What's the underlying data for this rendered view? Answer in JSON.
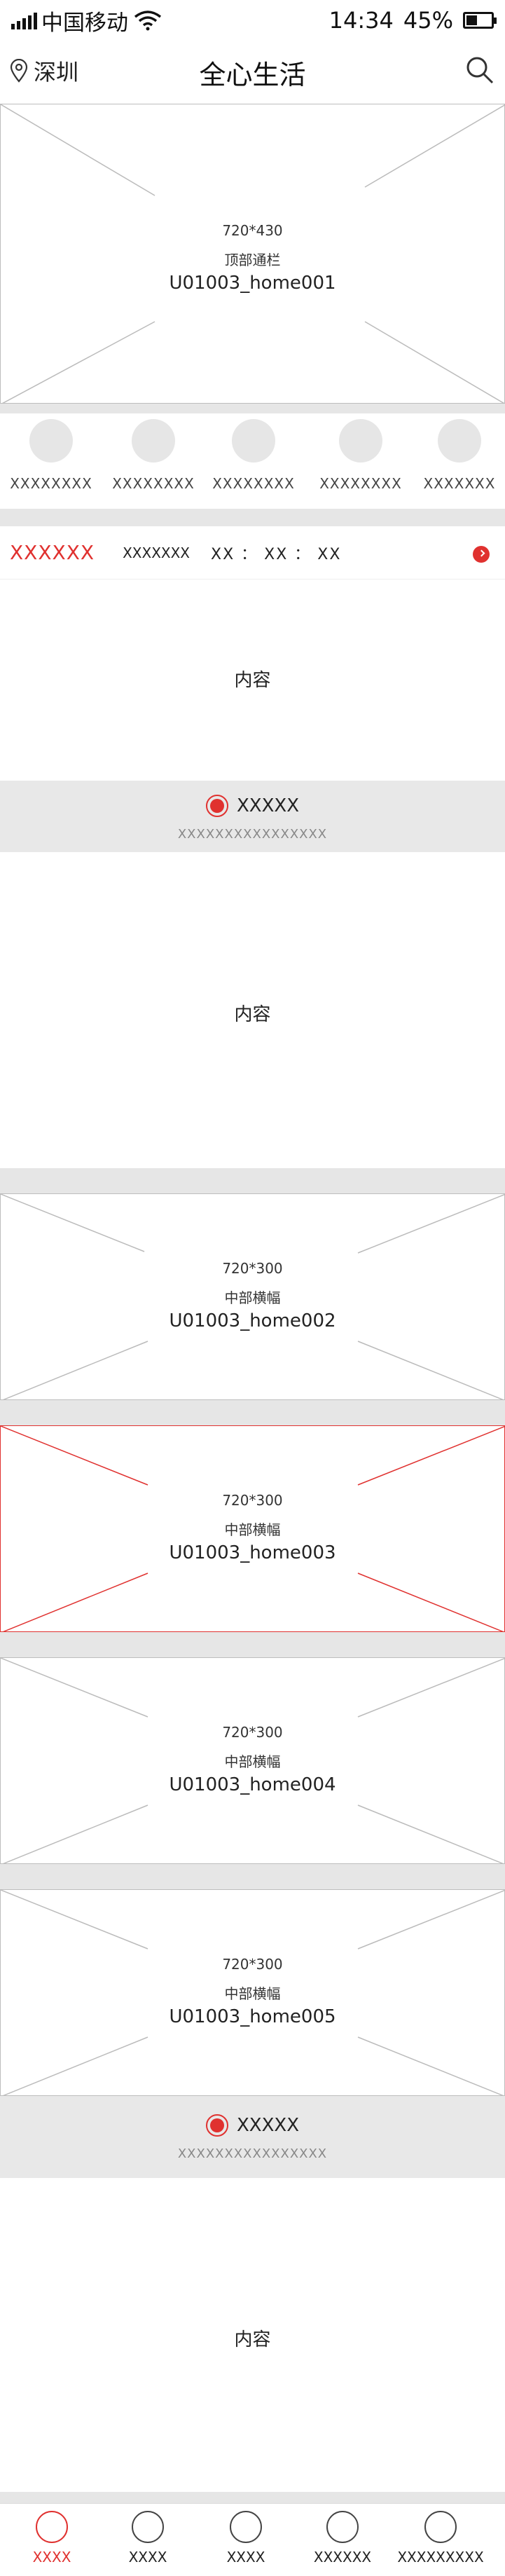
{
  "status_bar": {
    "carrier": "中国移动",
    "time": "14:34",
    "battery": "45%",
    "battery_level": 0.45
  },
  "header": {
    "location": "深圳",
    "title": "全心生活"
  },
  "top_banner": {
    "size": "720*430",
    "name": "顶部通栏",
    "code": "U01003_home001"
  },
  "icon_row": {
    "items": [
      "XXXXXXXX",
      "XXXXXXXX",
      "XXXXXXXX",
      "XXXXXXXX",
      "XXXXXXX"
    ]
  },
  "flash_sale": {
    "title": "XXXXXX",
    "subtitle": "XXXXXXX",
    "timer": "XX ： XX ： XX"
  },
  "content_label": "内容",
  "section_hot": {
    "title": "XXXXX",
    "subtitle": "XXXXXXXXXXXXXXXX"
  },
  "banners": [
    {
      "size": "720*300",
      "name": "中部横幅",
      "code": "U01003_home002"
    },
    {
      "size": "720*300",
      "name": "中部横幅",
      "code": "U01003_home003"
    },
    {
      "size": "720*300",
      "name": "中部横幅",
      "code": "U01003_home004"
    },
    {
      "size": "720*300",
      "name": "中部横幅",
      "code": "U01003_home005"
    }
  ],
  "section_recommend": {
    "title": "XXXXX",
    "subtitle": "XXXXXXXXXXXXXXXX"
  },
  "bottom_nav": {
    "items": [
      "XXXX",
      "XXXX",
      "XXXX",
      "XXXXXX",
      "XXXXXXXXX"
    ],
    "active_index": 0
  },
  "colors": {
    "accent": "#e0312f",
    "divider": "#e6e6e6"
  }
}
